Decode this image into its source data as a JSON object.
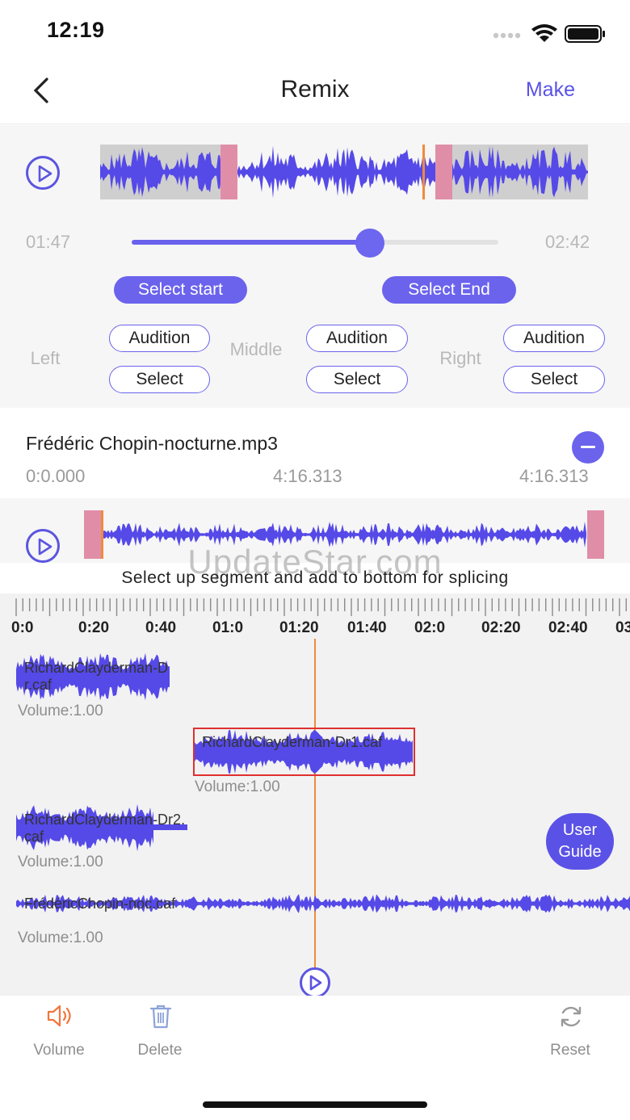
{
  "status_bar": {
    "time": "12:19"
  },
  "nav": {
    "title": "Remix",
    "make_label": "Make"
  },
  "top_panel": {
    "start_time": "01:47",
    "end_time": "02:42",
    "slider_value_fraction": 0.65,
    "select_start_label": "Select start",
    "select_end_label": "Select End",
    "zones": [
      {
        "label": "Left",
        "audition_label": "Audition",
        "select_label": "Select"
      },
      {
        "label": "Middle",
        "audition_label": "Audition",
        "select_label": "Select"
      },
      {
        "label": "Right",
        "audition_label": "Audition",
        "select_label": "Select"
      }
    ]
  },
  "file": {
    "name": "Frédéric Chopin-nocturne.mp3",
    "start": "0:0.000",
    "mid": "4:16.313",
    "end": "4:16.313"
  },
  "watermark": "UpdateStar.com",
  "hint": "Select up segment and add to bottom for splicing",
  "timeline": {
    "ticks": [
      "0:0",
      "0:20",
      "0:40",
      "01:0",
      "01:20",
      "01:40",
      "02:0",
      "02:20",
      "02:40",
      "03"
    ],
    "tracks": [
      {
        "name": "RichardClayderman-Dr.caf",
        "volume": "Volume:1.00"
      },
      {
        "name": "RichardClayderman-Dr1.caf",
        "volume": "Volume:1.00"
      },
      {
        "name": "RichardClayderman-Dr2.caf",
        "volume": "Volume:1.00"
      },
      {
        "name": "FrédéricChopin-noc.caf",
        "volume": "Volume:1.00"
      }
    ]
  },
  "user_guide_label": "User Guide",
  "toolbar": {
    "volume_label": "Volume",
    "delete_label": "Delete",
    "reset_label": "Reset"
  },
  "colors": {
    "accent": "#5a52e6",
    "wave": "#5549e8",
    "handle": "#e08ea8",
    "playhead": "#f08a3c",
    "volume_icon": "#f0763c"
  }
}
